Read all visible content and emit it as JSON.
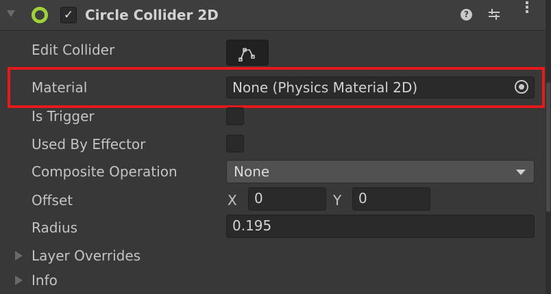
{
  "header": {
    "title": "Circle Collider 2D",
    "enabled_mark": "✓",
    "help_mark": "?",
    "menu_mark": "⋮",
    "icons": [
      "foldout-arrow-icon",
      "circle-collider-icon",
      "help-icon",
      "presets-icon",
      "context-menu-icon"
    ]
  },
  "edit_collider": {
    "label": "Edit Collider",
    "icon": "edit-collider-icon"
  },
  "material": {
    "label": "Material",
    "value": "None (Physics Material 2D)",
    "icon": "object-picker-icon"
  },
  "is_trigger": {
    "label": "Is Trigger",
    "checked": false
  },
  "used_by_effector": {
    "label": "Used By Effector",
    "checked": false
  },
  "composite_operation": {
    "label": "Composite Operation",
    "value": "None"
  },
  "offset": {
    "label": "Offset",
    "x_label": "X",
    "x_value": "0",
    "y_label": "Y",
    "y_value": "0"
  },
  "radius": {
    "label": "Radius",
    "value": "0.195"
  },
  "foldouts": {
    "layer_overrides": "Layer Overrides",
    "info": "Info"
  },
  "colors": {
    "highlight": "#e8191a",
    "collider_icon": "#9fd23a",
    "background": "#383838"
  }
}
